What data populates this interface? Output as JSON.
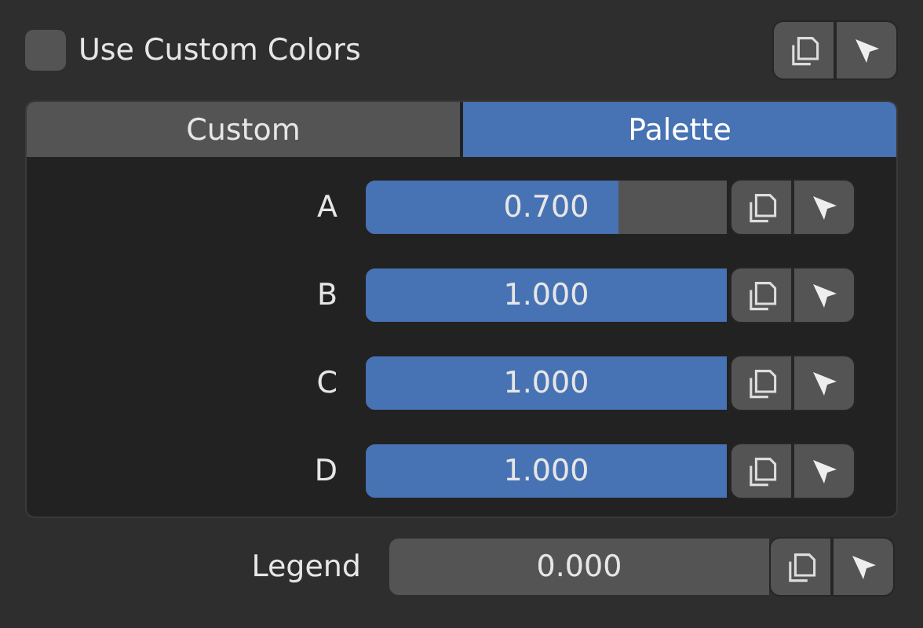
{
  "use_custom_colors": {
    "label": "Use Custom Colors",
    "checked": false
  },
  "tabs": [
    {
      "label": "Custom",
      "selected": false
    },
    {
      "label": "Palette",
      "selected": true
    }
  ],
  "channels": [
    {
      "name": "A",
      "value": "0.700",
      "level": 0.7
    },
    {
      "name": "B",
      "value": "1.000",
      "level": 1
    },
    {
      "name": "C",
      "value": "1.000",
      "level": 1
    },
    {
      "name": "D",
      "value": "1.000",
      "level": 1
    }
  ],
  "legend": {
    "label": "Legend",
    "value": "0.000"
  }
}
